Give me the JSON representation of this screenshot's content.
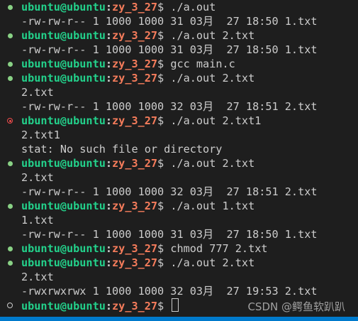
{
  "prompt": {
    "user": "ubuntu@ubuntu",
    "colon": ":",
    "path": "zy_3_27",
    "dollar": "$ "
  },
  "lines": [
    {
      "kind": "prompt",
      "status": "ok",
      "cmd": "./a.out"
    },
    {
      "kind": "output",
      "text": "-rw-rw-r-- 1 1000 1000 31 03月  27 18:50 1.txt"
    },
    {
      "kind": "prompt",
      "status": "ok",
      "cmd": "./a.out 2.txt"
    },
    {
      "kind": "output",
      "text": "-rw-rw-r-- 1 1000 1000 31 03月  27 18:50 1.txt"
    },
    {
      "kind": "prompt",
      "status": "ok",
      "cmd": "gcc main.c"
    },
    {
      "kind": "prompt",
      "status": "ok",
      "cmd": "./a.out 2.txt"
    },
    {
      "kind": "output",
      "text": "2.txt"
    },
    {
      "kind": "output",
      "text": "-rw-rw-r-- 1 1000 1000 32 03月  27 18:51 2.txt"
    },
    {
      "kind": "prompt",
      "status": "fail",
      "cmd": "./a.out 2.txt1"
    },
    {
      "kind": "output",
      "text": "2.txt1"
    },
    {
      "kind": "output",
      "text": "stat: No such file or directory"
    },
    {
      "kind": "prompt",
      "status": "ok",
      "cmd": "./a.out 2.txt"
    },
    {
      "kind": "output",
      "text": "2.txt"
    },
    {
      "kind": "output",
      "text": "-rw-rw-r-- 1 1000 1000 32 03月  27 18:51 2.txt"
    },
    {
      "kind": "prompt",
      "status": "ok",
      "cmd": "./a.out 1.txt"
    },
    {
      "kind": "output",
      "text": "1.txt"
    },
    {
      "kind": "output",
      "text": "-rw-rw-r-- 1 1000 1000 31 03月  27 18:50 1.txt"
    },
    {
      "kind": "prompt",
      "status": "ok",
      "cmd": "chmod 777 2.txt"
    },
    {
      "kind": "prompt",
      "status": "ok",
      "cmd": "./a.out 2.txt"
    },
    {
      "kind": "output",
      "text": "2.txt"
    },
    {
      "kind": "output",
      "text": "-rwxrwxrwx 1 1000 1000 32 03月  27 19:53 2.txt"
    },
    {
      "kind": "prompt",
      "status": "empty",
      "cmd": ""
    }
  ],
  "watermark": "CSDN @鳄鱼软趴趴",
  "colors": {
    "background": "#1e1e1e",
    "user": "#23d18b",
    "path": "#f57c5b",
    "status_ok": "#89d185",
    "status_fail": "#f14c4c",
    "statusbar": "#007acc"
  }
}
